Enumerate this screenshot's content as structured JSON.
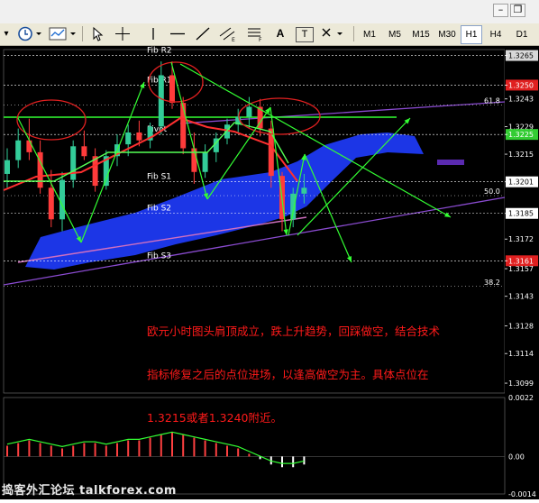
{
  "toolbar": {
    "timeframes": [
      "M1",
      "M5",
      "M15",
      "M30",
      "H1",
      "H4",
      "D1"
    ],
    "active_timeframe": "H1",
    "tools": [
      "cursor-icon",
      "crosshair-icon",
      "vline-icon",
      "hline-icon",
      "trendline-icon",
      "equidistant-channel-icon",
      "fibonacci-icon",
      "text-icon",
      "text-label-icon",
      "arrows-icon"
    ],
    "tool_labels": {
      "text": "A",
      "label": "T"
    }
  },
  "window_buttons": {
    "minimize": "–",
    "restore": "❐"
  },
  "annotation": {
    "lines": [
      "欧元小时图头肩顶成立，跌上升趋势，回踩做空，结合技术",
      "指标修复之后的点位进场，以逢高做空为主。具体点位在",
      "1.3215或者1.3240附近。"
    ],
    "color": "#ff1a1a"
  },
  "watermark": "捣客外汇论坛 talkforex.com",
  "colors": {
    "background": "#000000",
    "bull": "#33cc99",
    "bear": "#ff3b3b",
    "ichimoku_cloud": "#1f3cff",
    "pivot_levels": "#ffffff",
    "green_lines": "#33ff33",
    "purple_lines": "#8a4bd0",
    "macd_bars_positive": "#ff4040",
    "macd_signal": "#33ff33"
  },
  "chart_data": {
    "type": "candlestick",
    "price_axis": {
      "labels": [
        "1.3265",
        "1.3250",
        "1.3243",
        "1.3229",
        "1.3225",
        "1.3215",
        "1.3201",
        "1.3185",
        "1.3172",
        "1.3161",
        "1.3157",
        "1.3143",
        "1.3128",
        "1.3114",
        "1.3099"
      ],
      "highlighted": {
        "1.3265": "#d8d8d8",
        "1.3250": "#e02020",
        "1.3225": "#33cc33",
        "1.3201": "#ffffff",
        "1.3185": "#ffffff",
        "1.3161": "#e02020"
      },
      "ylim": [
        1.3094,
        1.3268
      ]
    },
    "pivot_labels": [
      {
        "name": "Fib R2",
        "value": 1.3265
      },
      {
        "name": "Fib R1",
        "value": 1.325
      },
      {
        "name": "Pivot",
        "value": 1.3225
      },
      {
        "name": "Fib S1",
        "value": 1.3201
      },
      {
        "name": "Fib S2",
        "value": 1.3185
      },
      {
        "name": "Fib S3",
        "value": 1.3161
      }
    ],
    "fib_levels": [
      {
        "label": "61.8",
        "value": 1.324
      },
      {
        "label": "50.0",
        "value": 1.3194
      },
      {
        "label": "38.2",
        "value": 1.3148
      }
    ],
    "candles": [
      [
        1.3205,
        1.3218,
        1.3198,
        1.3212
      ],
      [
        1.3212,
        1.3228,
        1.3208,
        1.3222
      ],
      [
        1.3222,
        1.3233,
        1.3212,
        1.3216
      ],
      [
        1.3216,
        1.3222,
        1.3195,
        1.3198
      ],
      [
        1.3198,
        1.3207,
        1.3178,
        1.3182
      ],
      [
        1.3182,
        1.3206,
        1.3176,
        1.3202
      ],
      [
        1.3202,
        1.3222,
        1.3198,
        1.3219
      ],
      [
        1.3219,
        1.3227,
        1.3212,
        1.3214
      ],
      [
        1.3214,
        1.3218,
        1.3196,
        1.3199
      ],
      [
        1.3199,
        1.3217,
        1.3197,
        1.3214
      ],
      [
        1.3214,
        1.3225,
        1.3209,
        1.322
      ],
      [
        1.322,
        1.323,
        1.3214,
        1.3226
      ],
      [
        1.3226,
        1.3232,
        1.3219,
        1.3222
      ],
      [
        1.3222,
        1.3231,
        1.3218,
        1.3229
      ],
      [
        1.3229,
        1.3262,
        1.3225,
        1.3255
      ],
      [
        1.3255,
        1.3262,
        1.3238,
        1.3241
      ],
      [
        1.3241,
        1.3244,
        1.3215,
        1.3218
      ],
      [
        1.3218,
        1.3226,
        1.32,
        1.3206
      ],
      [
        1.3206,
        1.322,
        1.3203,
        1.3216
      ],
      [
        1.3216,
        1.3226,
        1.3211,
        1.3223
      ],
      [
        1.3223,
        1.3233,
        1.322,
        1.323
      ],
      [
        1.323,
        1.3238,
        1.3226,
        1.3234
      ],
      [
        1.3234,
        1.3244,
        1.3228,
        1.3239
      ],
      [
        1.3239,
        1.3243,
        1.3224,
        1.3228
      ],
      [
        1.3228,
        1.3232,
        1.3198,
        1.3204
      ],
      [
        1.3204,
        1.3206,
        1.3176,
        1.3182
      ],
      [
        1.3182,
        1.3198,
        1.3178,
        1.3195
      ],
      [
        1.3195,
        1.3205,
        1.319,
        1.3198
      ]
    ],
    "macd": {
      "values": [
        0.0004,
        0.0005,
        0.0006,
        0.0005,
        0.0004,
        0.0003,
        0.0004,
        0.0005,
        0.0005,
        0.0004,
        0.0005,
        0.0006,
        0.0006,
        0.0007,
        0.0008,
        0.0009,
        0.0008,
        0.0007,
        0.0006,
        0.0005,
        0.0004,
        0.0003,
        0.0001,
        -0.0001,
        -0.0003,
        -0.0004,
        -0.0004,
        -0.0003
      ],
      "scale_labels": [
        "0.0022",
        "0.00",
        "-0.0014"
      ],
      "ylim": [
        -0.0014,
        0.0022
      ]
    }
  }
}
